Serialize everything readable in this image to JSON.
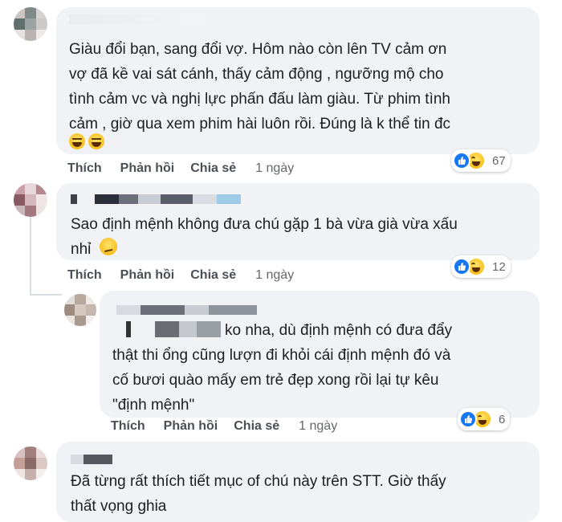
{
  "comments": [
    {
      "text": "Giàu đổi bạn, sang đổi vợ. Hôm nào còn lên TV cảm ơn\nvợ đã kề vai sát cánh, thấy cảm động , ngưỡng mộ cho\ntình cảm vc và nghị lực phấn đấu làm giàu. Từ phim tình\ncảm , giờ qua xem phim hài luôn rồi. Đúng là k thể tin đc",
      "like_label": "Thích",
      "reply_label": "Phản hồi",
      "share_label": "Chia sẻ",
      "time": "1 ngày",
      "reaction_count": "67"
    },
    {
      "text": "Sao định mệnh không đưa chú gặp 1 bà vừa già vừa xấu\nnhỉ",
      "like_label": "Thích",
      "reply_label": "Phản hồi",
      "share_label": "Chia sẻ",
      "time": "1 ngày",
      "reaction_count": "12"
    },
    {
      "text_first": "ko nha, dù định mệnh có đưa đẩy",
      "text": "thật thi ổng cũng lượn đi khỏi cái định mệnh đó và\ncố bươi quào mấy em trẻ đẹp xong rồi lại tự kêu\n\"định mệnh\"",
      "like_label": "Thích",
      "reply_label": "Phản hồi",
      "share_label": "Chia sẻ",
      "time": "1 ngày",
      "reaction_count": "6"
    },
    {
      "text": "Đã từng rất thích tiết mục of chú này trên STT. Giờ thấy\nthất vọng ghia"
    }
  ],
  "icons": {
    "like": "like-reaction-icon",
    "haha": "haha-reaction-icon",
    "grin": "grinning-emoji-icon",
    "smirk": "smirk-emoji-icon"
  },
  "colors": {
    "bubble": "#f0f2f5",
    "like_blue": "#1877f2",
    "action_text": "#4a4e55"
  }
}
